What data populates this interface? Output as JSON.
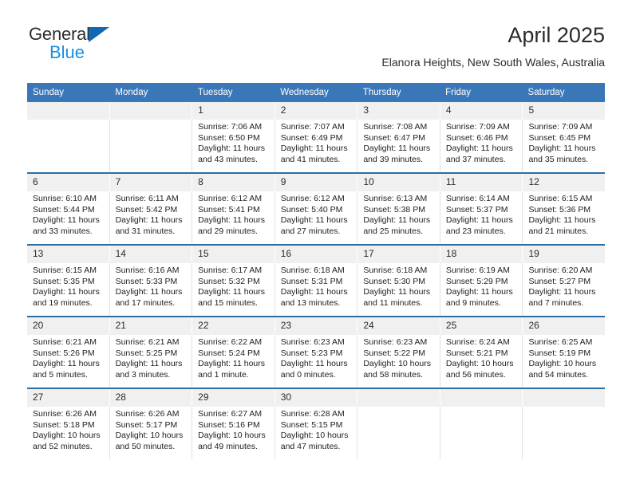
{
  "logo": {
    "word_one": "General",
    "word_two": "Blue",
    "triangle_icon": "triangle-icon",
    "colors": {
      "general": "#2d2d2d",
      "blue": "#1a8fe0",
      "triangle": "#1268b3"
    }
  },
  "header": {
    "title": "April 2025",
    "subtitle": "Elanora Heights, New South Wales, Australia"
  },
  "theme": {
    "header_blue": "#3a77b8",
    "divider_blue": "#2d6da4",
    "daynum_band": "#f0f0f0"
  },
  "weekdays": [
    "Sunday",
    "Monday",
    "Tuesday",
    "Wednesday",
    "Thursday",
    "Friday",
    "Saturday"
  ],
  "weeks": [
    [
      {
        "day": "",
        "lines": []
      },
      {
        "day": "",
        "lines": []
      },
      {
        "day": "1",
        "lines": [
          "Sunrise: 7:06 AM",
          "Sunset: 6:50 PM",
          "Daylight: 11 hours",
          "and 43 minutes."
        ]
      },
      {
        "day": "2",
        "lines": [
          "Sunrise: 7:07 AM",
          "Sunset: 6:49 PM",
          "Daylight: 11 hours",
          "and 41 minutes."
        ]
      },
      {
        "day": "3",
        "lines": [
          "Sunrise: 7:08 AM",
          "Sunset: 6:47 PM",
          "Daylight: 11 hours",
          "and 39 minutes."
        ]
      },
      {
        "day": "4",
        "lines": [
          "Sunrise: 7:09 AM",
          "Sunset: 6:46 PM",
          "Daylight: 11 hours",
          "and 37 minutes."
        ]
      },
      {
        "day": "5",
        "lines": [
          "Sunrise: 7:09 AM",
          "Sunset: 6:45 PM",
          "Daylight: 11 hours",
          "and 35 minutes."
        ]
      }
    ],
    [
      {
        "day": "6",
        "lines": [
          "Sunrise: 6:10 AM",
          "Sunset: 5:44 PM",
          "Daylight: 11 hours",
          "and 33 minutes."
        ]
      },
      {
        "day": "7",
        "lines": [
          "Sunrise: 6:11 AM",
          "Sunset: 5:42 PM",
          "Daylight: 11 hours",
          "and 31 minutes."
        ]
      },
      {
        "day": "8",
        "lines": [
          "Sunrise: 6:12 AM",
          "Sunset: 5:41 PM",
          "Daylight: 11 hours",
          "and 29 minutes."
        ]
      },
      {
        "day": "9",
        "lines": [
          "Sunrise: 6:12 AM",
          "Sunset: 5:40 PM",
          "Daylight: 11 hours",
          "and 27 minutes."
        ]
      },
      {
        "day": "10",
        "lines": [
          "Sunrise: 6:13 AM",
          "Sunset: 5:38 PM",
          "Daylight: 11 hours",
          "and 25 minutes."
        ]
      },
      {
        "day": "11",
        "lines": [
          "Sunrise: 6:14 AM",
          "Sunset: 5:37 PM",
          "Daylight: 11 hours",
          "and 23 minutes."
        ]
      },
      {
        "day": "12",
        "lines": [
          "Sunrise: 6:15 AM",
          "Sunset: 5:36 PM",
          "Daylight: 11 hours",
          "and 21 minutes."
        ]
      }
    ],
    [
      {
        "day": "13",
        "lines": [
          "Sunrise: 6:15 AM",
          "Sunset: 5:35 PM",
          "Daylight: 11 hours",
          "and 19 minutes."
        ]
      },
      {
        "day": "14",
        "lines": [
          "Sunrise: 6:16 AM",
          "Sunset: 5:33 PM",
          "Daylight: 11 hours",
          "and 17 minutes."
        ]
      },
      {
        "day": "15",
        "lines": [
          "Sunrise: 6:17 AM",
          "Sunset: 5:32 PM",
          "Daylight: 11 hours",
          "and 15 minutes."
        ]
      },
      {
        "day": "16",
        "lines": [
          "Sunrise: 6:18 AM",
          "Sunset: 5:31 PM",
          "Daylight: 11 hours",
          "and 13 minutes."
        ]
      },
      {
        "day": "17",
        "lines": [
          "Sunrise: 6:18 AM",
          "Sunset: 5:30 PM",
          "Daylight: 11 hours",
          "and 11 minutes."
        ]
      },
      {
        "day": "18",
        "lines": [
          "Sunrise: 6:19 AM",
          "Sunset: 5:29 PM",
          "Daylight: 11 hours",
          "and 9 minutes."
        ]
      },
      {
        "day": "19",
        "lines": [
          "Sunrise: 6:20 AM",
          "Sunset: 5:27 PM",
          "Daylight: 11 hours",
          "and 7 minutes."
        ]
      }
    ],
    [
      {
        "day": "20",
        "lines": [
          "Sunrise: 6:21 AM",
          "Sunset: 5:26 PM",
          "Daylight: 11 hours",
          "and 5 minutes."
        ]
      },
      {
        "day": "21",
        "lines": [
          "Sunrise: 6:21 AM",
          "Sunset: 5:25 PM",
          "Daylight: 11 hours",
          "and 3 minutes."
        ]
      },
      {
        "day": "22",
        "lines": [
          "Sunrise: 6:22 AM",
          "Sunset: 5:24 PM",
          "Daylight: 11 hours",
          "and 1 minute."
        ]
      },
      {
        "day": "23",
        "lines": [
          "Sunrise: 6:23 AM",
          "Sunset: 5:23 PM",
          "Daylight: 11 hours",
          "and 0 minutes."
        ]
      },
      {
        "day": "24",
        "lines": [
          "Sunrise: 6:23 AM",
          "Sunset: 5:22 PM",
          "Daylight: 10 hours",
          "and 58 minutes."
        ]
      },
      {
        "day": "25",
        "lines": [
          "Sunrise: 6:24 AM",
          "Sunset: 5:21 PM",
          "Daylight: 10 hours",
          "and 56 minutes."
        ]
      },
      {
        "day": "26",
        "lines": [
          "Sunrise: 6:25 AM",
          "Sunset: 5:19 PM",
          "Daylight: 10 hours",
          "and 54 minutes."
        ]
      }
    ],
    [
      {
        "day": "27",
        "lines": [
          "Sunrise: 6:26 AM",
          "Sunset: 5:18 PM",
          "Daylight: 10 hours",
          "and 52 minutes."
        ]
      },
      {
        "day": "28",
        "lines": [
          "Sunrise: 6:26 AM",
          "Sunset: 5:17 PM",
          "Daylight: 10 hours",
          "and 50 minutes."
        ]
      },
      {
        "day": "29",
        "lines": [
          "Sunrise: 6:27 AM",
          "Sunset: 5:16 PM",
          "Daylight: 10 hours",
          "and 49 minutes."
        ]
      },
      {
        "day": "30",
        "lines": [
          "Sunrise: 6:28 AM",
          "Sunset: 5:15 PM",
          "Daylight: 10 hours",
          "and 47 minutes."
        ]
      },
      {
        "day": "",
        "lines": []
      },
      {
        "day": "",
        "lines": []
      },
      {
        "day": "",
        "lines": []
      }
    ]
  ]
}
